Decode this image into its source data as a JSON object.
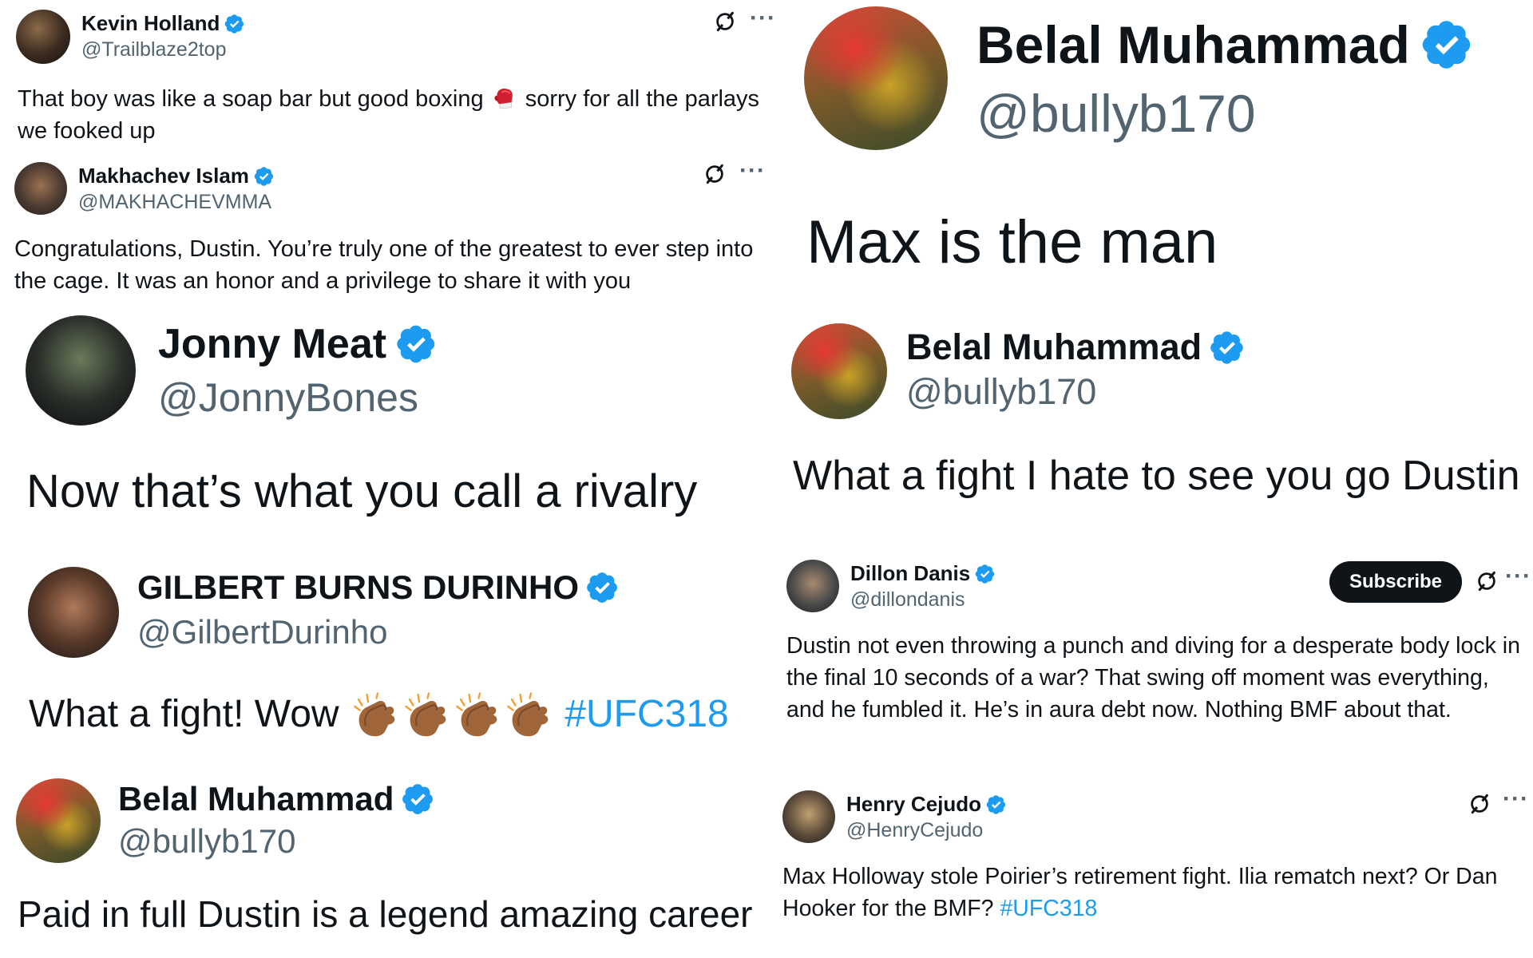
{
  "tweets": {
    "kevin": {
      "name": "Kevin Holland",
      "handle": "@Trailblaze2top",
      "text_before": "That boy was like a soap bar but good boxing",
      "text_after": "sorry for all the parlays we fooked up",
      "emoji": "boxing-glove-icon"
    },
    "makhachev": {
      "name": "Makhachev Islam",
      "handle": "@MAKHACHEVMMA",
      "text": "Congratulations, Dustin. You’re truly one of the greatest to ever step into the cage. It was an honor and a privilege to share it with you"
    },
    "jonny": {
      "name": "Jonny Meat",
      "handle": "@JonnyBones",
      "text": "Now that’s what you call a rivalry"
    },
    "gilbert": {
      "name": "GILBERT BURNS DURINHO",
      "handle": "@GilbertDurinho",
      "text": "What a fight! Wow",
      "emoji": "clapping-hands-icon",
      "hashtag": "#UFC318"
    },
    "belal_bottom": {
      "name": "Belal Muhammad",
      "handle": "@bullyb170",
      "text": "Paid in full Dustin is a legend amazing career"
    },
    "belal_top": {
      "name": "Belal Muhammad",
      "handle": "@bullyb170",
      "text": "Max is the man"
    },
    "belal_mid": {
      "name": "Belal Muhammad",
      "handle": "@bullyb170",
      "text": "What a fight I hate to see you go Dustin"
    },
    "dillon": {
      "name": "Dillon Danis",
      "handle": "@dillondanis",
      "subscribe": "Subscribe",
      "text": "Dustin not even throwing a punch and diving for a desperate body lock in the final 10 seconds of a war? That swing off moment was everything, and he fumbled it. He’s in aura debt now. Nothing BMF about that."
    },
    "henry": {
      "name": "Henry Cejudo",
      "handle": "@HenryCejudo",
      "text": "Max Holloway stole Poirier’s retirement fight. Ilia rematch next? Or Dan Hooker for the BMF?",
      "hashtag": "#UFC318"
    }
  },
  "icons": {
    "verified": "verified-badge-icon",
    "grok": "grok-icon",
    "more": "more-options-icon",
    "more_text": "···"
  },
  "colors": {
    "verified_blue": "#1d9bf0",
    "handle_gray": "#536471",
    "text": "#0f1419",
    "hashtag": "#1d9bf0"
  }
}
